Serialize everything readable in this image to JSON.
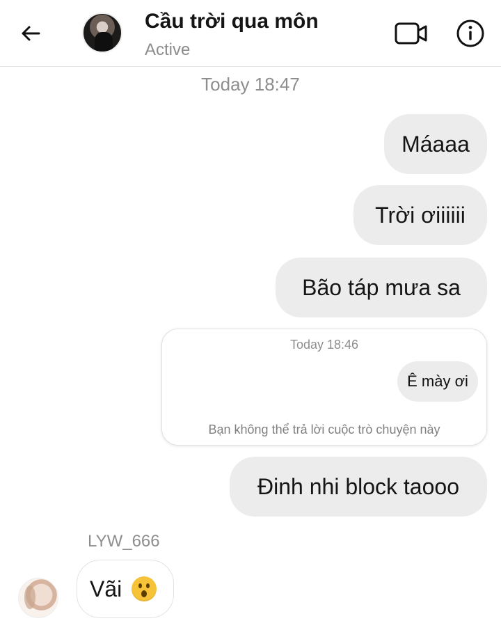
{
  "header": {
    "title": "Cầu trời qua môn",
    "status": "Active",
    "icons": {
      "back": "back-arrow-icon",
      "video": "video-call-icon",
      "info": "info-icon"
    }
  },
  "chat": {
    "timestamp": "Today 18:47",
    "outgoing_messages": [
      {
        "text": "Máaaa"
      },
      {
        "text": "Trời ơiiiiii"
      },
      {
        "text": "Bão táp mưa sa"
      }
    ],
    "reply_card": {
      "timestamp": "Today 18:46",
      "quoted_message": "Ê mày ơi",
      "note": "Bạn không thể trả lời cuộc trò chuyện này"
    },
    "outgoing_last": {
      "text": "Đinh nhi block taooo"
    },
    "incoming": {
      "sender_name": "LYW_666",
      "text": "Vãi",
      "emoji": "astonished-face"
    }
  },
  "colors": {
    "bubble_gray": "#ececec",
    "text_muted": "#8e8e8e",
    "background": "#ffffff"
  }
}
